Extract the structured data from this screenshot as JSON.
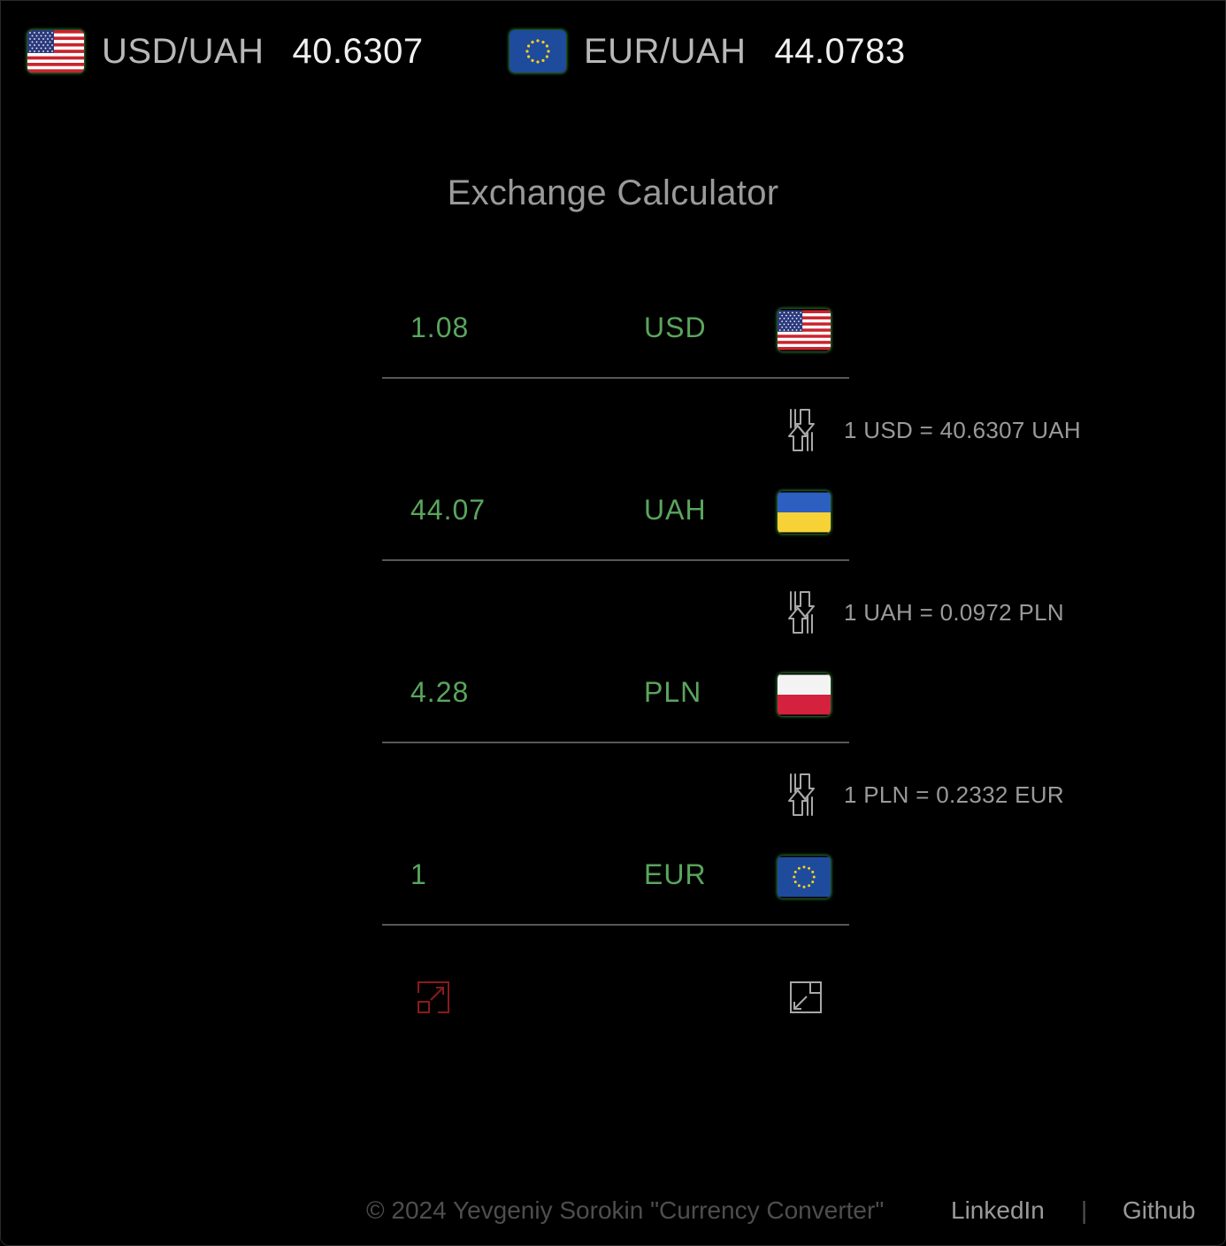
{
  "header": {
    "rates": [
      {
        "pair": "USD/UAH",
        "value": "40.6307",
        "flag": "us-flag-icon"
      },
      {
        "pair": "EUR/UAH",
        "value": "44.0783",
        "flag": "eu-flag-icon"
      }
    ]
  },
  "calculator": {
    "title": "Exchange Calculator",
    "rows": [
      {
        "amount": "1.08",
        "code": "USD",
        "flag": "us-flag-icon"
      },
      {
        "amount": "44.07",
        "code": "UAH",
        "flag": "ua-flag-icon"
      },
      {
        "amount": "4.28",
        "code": "PLN",
        "flag": "pl-flag-icon"
      },
      {
        "amount": "1",
        "code": "EUR",
        "flag": "eu-flag-icon"
      }
    ],
    "conversions": [
      {
        "text": "1 USD = 40.6307 UAH",
        "icon": "swap-arrows-icon"
      },
      {
        "text": "1 UAH = 0.0972 PLN",
        "icon": "swap-arrows-icon"
      },
      {
        "text": "1 PLN = 0.2332 EUR",
        "icon": "swap-arrows-icon"
      }
    ],
    "controls": {
      "expand_icon": "expand-icon",
      "collapse_icon": "collapse-icon"
    }
  },
  "footer": {
    "copyright": "© 2024 Yevgeniy Sorokin \"Currency Converter\"",
    "linkedin": "LinkedIn",
    "separator": "|",
    "github": "Github"
  },
  "colors": {
    "background": "#000000",
    "accent_green": "#5aa55e",
    "expand_red": "#8b1a1a",
    "muted_text": "#9a9a9a"
  }
}
